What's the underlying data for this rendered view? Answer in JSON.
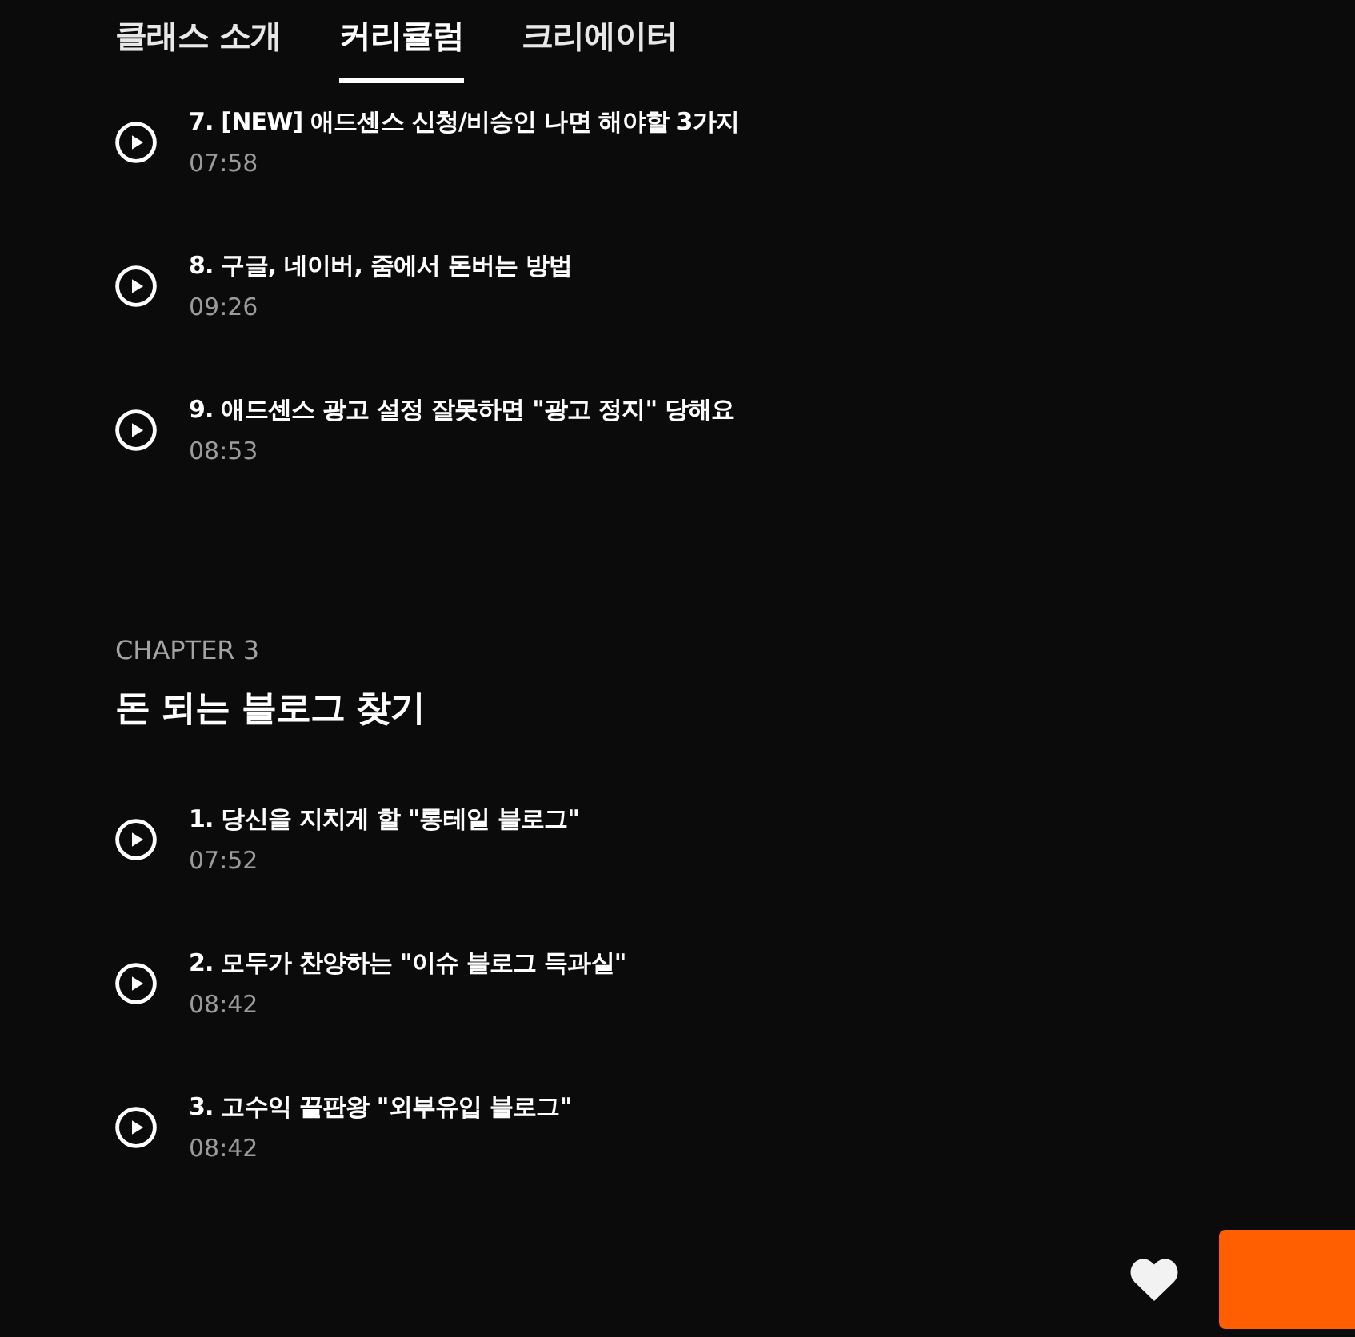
{
  "tabs": [
    {
      "label": "클래스 소개",
      "selected": false
    },
    {
      "label": "커리큘럼",
      "selected": true
    },
    {
      "label": "크리에이터",
      "selected": false
    }
  ],
  "sections": [
    {
      "lessons": [
        {
          "title": "7. [NEW] 애드센스 신청/비승인 나면 해야할 3가지",
          "duration": "07:58"
        },
        {
          "title": "8. 구글, 네이버, 줌에서 돈버는 방법",
          "duration": "09:26"
        },
        {
          "title": "9. 애드센스 광고 설정 잘못하면 \"광고 정지\" 당해요",
          "duration": "08:53"
        }
      ]
    },
    {
      "chapter_label": "CHAPTER 3",
      "title": "돈 되는 블로그 찾기",
      "lessons": [
        {
          "title": "1. 당신을 지치게 할 \"롱테일 블로그\"",
          "duration": "07:52"
        },
        {
          "title": "2. 모두가 찬양하는 \"이슈 블로그 득과실\"",
          "duration": "08:42"
        },
        {
          "title": "3. 고수익 끝판왕 \"외부유입 블로그\"",
          "duration": "08:42"
        }
      ]
    }
  ]
}
